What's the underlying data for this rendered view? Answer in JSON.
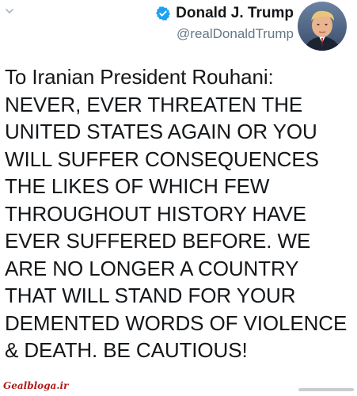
{
  "tweet": {
    "author_name": "Donald J. Trump",
    "author_handle": "@realDonaldTrump",
    "lines": [
      "To Iranian President Rouhani:",
      "NEVER, EVER THREATEN THE",
      "UNITED STATES AGAIN OR YOU",
      "WILL SUFFER CONSEQUENCES",
      "THE LIKES OF WHICH FEW",
      "THROUGHOUT HISTORY HAVE",
      "EVER SUFFERED BEFORE. WE",
      "ARE NO LONGER A COUNTRY",
      "THAT WILL STAND FOR YOUR",
      "DEMENTED WORDS OF VIOLENCE",
      "& DEATH. BE CAUTIOUS!"
    ]
  },
  "icons": {
    "menu": "chevron-down-icon",
    "verified": "verified-badge-icon",
    "avatar": "profile-avatar"
  },
  "watermark": {
    "left_text": "Gealbloga.ir"
  },
  "colors": {
    "verified": "#1da1f2",
    "handle": "#657786",
    "caret": "#aab8c2",
    "text": "#14171a",
    "watermark": "#b11b1b"
  }
}
